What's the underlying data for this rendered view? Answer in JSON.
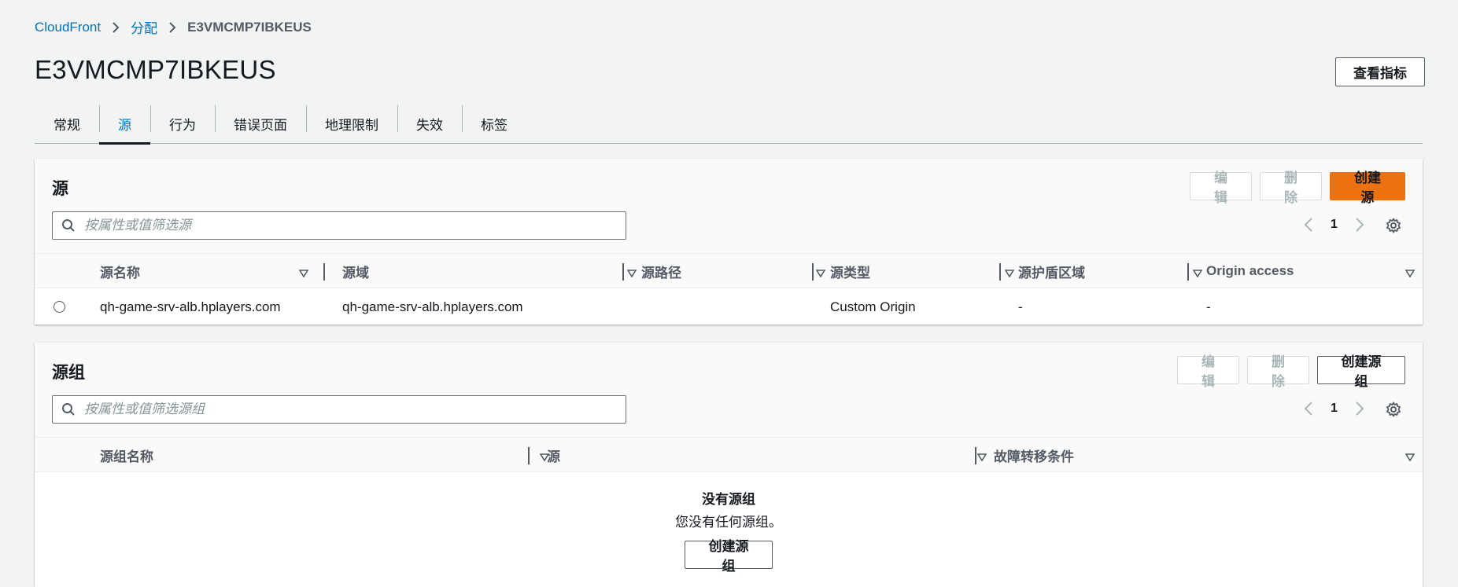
{
  "breadcrumb": {
    "root": "CloudFront",
    "level2": "分配",
    "current": "E3VMCMP7IBKEUS"
  },
  "page": {
    "title": "E3VMCMP7IBKEUS",
    "metrics_button": "查看指标"
  },
  "tabs": [
    {
      "label": "常规"
    },
    {
      "label": "源"
    },
    {
      "label": "行为"
    },
    {
      "label": "错误页面"
    },
    {
      "label": "地理限制"
    },
    {
      "label": "失效"
    },
    {
      "label": "标签"
    }
  ],
  "active_tab": "源",
  "origins_panel": {
    "title": "源",
    "edit": "编辑",
    "delete": "删除",
    "create": "创建源",
    "search_placeholder": "按属性或值筛选源",
    "page": "1",
    "columns": [
      "源名称",
      "源域",
      "源路径",
      "源类型",
      "源护盾区域",
      "Origin access"
    ],
    "rows": [
      {
        "name": "qh-game-srv-alb.hplayers.com",
        "domain": "qh-game-srv-alb.hplayers.com",
        "path": "",
        "type": "Custom Origin",
        "shield": "-",
        "access": "-"
      }
    ]
  },
  "origin_groups_panel": {
    "title": "源组",
    "edit": "编辑",
    "delete": "删除",
    "create": "创建源组",
    "search_placeholder": "按属性或值筛选源组",
    "page": "1",
    "columns": [
      "源组名称",
      "源",
      "故障转移条件"
    ],
    "empty_title": "没有源组",
    "empty_desc": "您没有任何源组。",
    "empty_button": "创建源组"
  },
  "colors": {
    "link": "#0073bb",
    "primary": "#ec7211",
    "text": "#16191f",
    "muted": "#545b64"
  }
}
